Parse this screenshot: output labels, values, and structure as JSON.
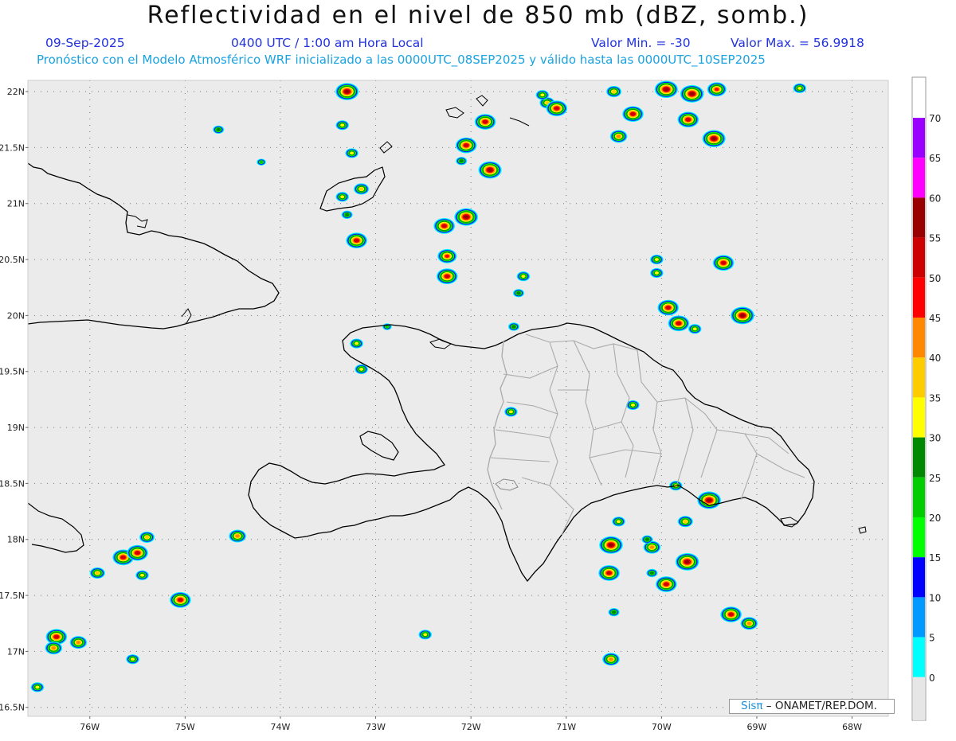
{
  "header": {
    "title": "Reflectividad en el nivel de 850 mb (dBZ, somb.)",
    "date": "09-Sep-2025",
    "time": "0400 UTC / 1:00 am Hora Local",
    "min_value": "Valor Min. = -30",
    "max_value": "Valor Max. = 56.9918",
    "forecast": "Pronóstico con el Modelo Atmosférico WRF inicializado a las 0000UTC_08SEP2025 y válido hasta las  0000UTC_10SEP2025"
  },
  "axes": {
    "lat_labels": [
      "22N",
      "21.5N",
      "21N",
      "20.5N",
      "20N",
      "19.5N",
      "19N",
      "18.5N",
      "18N",
      "17.5N",
      "17N",
      "16.5N"
    ],
    "lon_labels": [
      "76W",
      "75W",
      "74W",
      "73W",
      "72W",
      "71W",
      "70W",
      "69W",
      "68W"
    ],
    "lat_values": [
      22,
      21.5,
      21,
      20.5,
      20,
      19.5,
      19,
      18.5,
      18,
      17.5,
      17,
      16.5
    ],
    "lon_values": [
      -76,
      -75,
      -74,
      -73,
      -72,
      -71,
      -70,
      -69,
      -68
    ],
    "lat_range": [
      16.42,
      22.1
    ],
    "lon_range": [
      -76.65,
      -67.62
    ],
    "grid": "dotted"
  },
  "legend": {
    "labels": [
      "0",
      "5",
      "10",
      "15",
      "20",
      "25",
      "30",
      "35",
      "40",
      "45",
      "50",
      "55",
      "60",
      "65",
      "70"
    ],
    "colors": [
      "#e6e6e6",
      "#00ffff",
      "#0099ff",
      "#0000ff",
      "#00ff00",
      "#00cc00",
      "#008800",
      "#ffff00",
      "#ffcc00",
      "#ff8800",
      "#ff0000",
      "#cc0000",
      "#990000",
      "#ff00ff",
      "#9900ff",
      "#ffffff"
    ]
  },
  "credit": {
    "brand": "Sisπ",
    "rest": " – ONAMET/REP.DOM."
  },
  "colors": {
    "ocean": "#ebebeb",
    "coast": "#000000",
    "borders": "#aaaaaa"
  },
  "cells": [
    {
      "lon": -73.3,
      "lat": 22.0,
      "peak": 55
    },
    {
      "lon": -73.35,
      "lat": 21.7,
      "peak": 30
    },
    {
      "lon": -73.25,
      "lat": 21.45,
      "peak": 30
    },
    {
      "lon": -73.15,
      "lat": 21.13,
      "peak": 35
    },
    {
      "lon": -73.35,
      "lat": 21.06,
      "peak": 30
    },
    {
      "lon": -73.2,
      "lat": 20.67,
      "peak": 50
    },
    {
      "lon": -72.05,
      "lat": 21.52,
      "peak": 50
    },
    {
      "lon": -71.85,
      "lat": 21.73,
      "peak": 50
    },
    {
      "lon": -71.8,
      "lat": 21.3,
      "peak": 55
    },
    {
      "lon": -72.1,
      "lat": 21.38,
      "peak": 25
    },
    {
      "lon": -71.2,
      "lat": 21.9,
      "peak": 35
    },
    {
      "lon": -71.1,
      "lat": 21.85,
      "peak": 50
    },
    {
      "lon": -71.25,
      "lat": 21.97,
      "peak": 30
    },
    {
      "lon": -70.45,
      "lat": 21.6,
      "peak": 40
    },
    {
      "lon": -70.3,
      "lat": 21.8,
      "peak": 50
    },
    {
      "lon": -70.5,
      "lat": 22.0,
      "peak": 35
    },
    {
      "lon": -69.95,
      "lat": 22.02,
      "peak": 55
    },
    {
      "lon": -69.68,
      "lat": 21.98,
      "peak": 56
    },
    {
      "lon": -69.42,
      "lat": 22.02,
      "peak": 45
    },
    {
      "lon": -69.72,
      "lat": 21.75,
      "peak": 50
    },
    {
      "lon": -69.45,
      "lat": 21.58,
      "peak": 55
    },
    {
      "lon": -68.55,
      "lat": 22.03,
      "peak": 30
    },
    {
      "lon": -72.05,
      "lat": 20.88,
      "peak": 56
    },
    {
      "lon": -72.28,
      "lat": 20.8,
      "peak": 50
    },
    {
      "lon": -72.25,
      "lat": 20.53,
      "peak": 45
    },
    {
      "lon": -72.25,
      "lat": 20.35,
      "peak": 50
    },
    {
      "lon": -71.45,
      "lat": 20.35,
      "peak": 30
    },
    {
      "lon": -71.5,
      "lat": 20.2,
      "peak": 25
    },
    {
      "lon": -70.05,
      "lat": 20.5,
      "peak": 30
    },
    {
      "lon": -70.05,
      "lat": 20.38,
      "peak": 30
    },
    {
      "lon": -69.35,
      "lat": 20.47,
      "peak": 50
    },
    {
      "lon": -69.15,
      "lat": 20.0,
      "peak": 56
    },
    {
      "lon": -69.93,
      "lat": 20.07,
      "peak": 50
    },
    {
      "lon": -69.82,
      "lat": 19.93,
      "peak": 50
    },
    {
      "lon": -69.65,
      "lat": 19.88,
      "peak": 30
    },
    {
      "lon": -70.3,
      "lat": 19.2,
      "peak": 30
    },
    {
      "lon": -70.45,
      "lat": 18.16,
      "peak": 30
    },
    {
      "lon": -70.53,
      "lat": 17.95,
      "peak": 56
    },
    {
      "lon": -70.55,
      "lat": 17.7,
      "peak": 50
    },
    {
      "lon": -69.95,
      "lat": 17.6,
      "peak": 50
    },
    {
      "lon": -69.73,
      "lat": 17.8,
      "peak": 56
    },
    {
      "lon": -69.75,
      "lat": 18.16,
      "peak": 35
    },
    {
      "lon": -69.5,
      "lat": 18.35,
      "peak": 56
    },
    {
      "lon": -69.85,
      "lat": 18.48,
      "peak": 30
    },
    {
      "lon": -70.1,
      "lat": 17.93,
      "peak": 40
    },
    {
      "lon": -70.15,
      "lat": 18.0,
      "peak": 25
    },
    {
      "lon": -70.1,
      "lat": 17.7,
      "peak": 25
    },
    {
      "lon": -69.27,
      "lat": 17.33,
      "peak": 50
    },
    {
      "lon": -69.08,
      "lat": 17.25,
      "peak": 40
    },
    {
      "lon": -70.5,
      "lat": 17.35,
      "peak": 25
    },
    {
      "lon": -70.53,
      "lat": 16.93,
      "peak": 40
    },
    {
      "lon": -75.65,
      "lat": 17.84,
      "peak": 50
    },
    {
      "lon": -75.5,
      "lat": 17.88,
      "peak": 50
    },
    {
      "lon": -75.4,
      "lat": 18.02,
      "peak": 35
    },
    {
      "lon": -75.45,
      "lat": 17.68,
      "peak": 30
    },
    {
      "lon": -75.92,
      "lat": 17.7,
      "peak": 35
    },
    {
      "lon": -75.05,
      "lat": 17.46,
      "peak": 50
    },
    {
      "lon": -74.45,
      "lat": 18.03,
      "peak": 40
    },
    {
      "lon": -76.35,
      "lat": 17.13,
      "peak": 50
    },
    {
      "lon": -76.38,
      "lat": 17.03,
      "peak": 40
    },
    {
      "lon": -76.12,
      "lat": 17.08,
      "peak": 40
    },
    {
      "lon": -75.55,
      "lat": 16.93,
      "peak": 30
    },
    {
      "lon": -76.55,
      "lat": 16.68,
      "peak": 30
    },
    {
      "lon": -72.48,
      "lat": 17.15,
      "peak": 30
    },
    {
      "lon": -73.15,
      "lat": 19.52,
      "peak": 30
    },
    {
      "lon": -73.2,
      "lat": 19.75,
      "peak": 30
    },
    {
      "lon": -72.88,
      "lat": 19.9,
      "peak": 20
    },
    {
      "lon": -71.55,
      "lat": 19.9,
      "peak": 25
    },
    {
      "lon": -71.58,
      "lat": 19.14,
      "peak": 30
    },
    {
      "lon": -73.3,
      "lat": 20.9,
      "peak": 25
    },
    {
      "lon": -74.65,
      "lat": 21.66,
      "peak": 25
    },
    {
      "lon": -74.2,
      "lat": 21.37,
      "peak": 20
    }
  ]
}
